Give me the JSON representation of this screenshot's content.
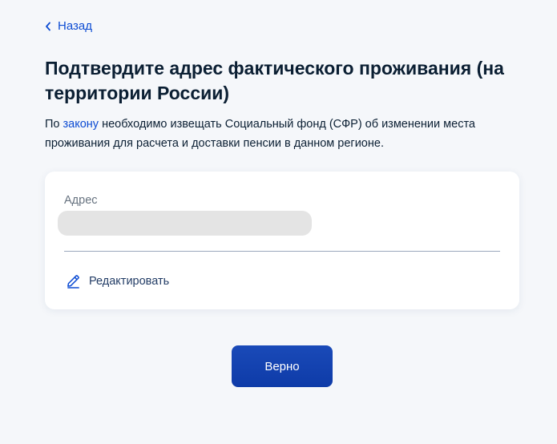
{
  "nav": {
    "back_label": "Назад",
    "back_icon": "chevron-left-icon"
  },
  "page": {
    "title": "Подтвердите адрес фактического проживания (на территории России)",
    "description_prefix": "По ",
    "description_link": "закону",
    "description_suffix": " необходимо извещать Социальный фонд (СФР) об изменении места проживания для расчета и доставки пенсии в данном регионе."
  },
  "address_card": {
    "label": "Адрес",
    "value_loading": true,
    "edit_label": "Редактировать",
    "edit_icon": "pencil-icon"
  },
  "actions": {
    "confirm_label": "Верно"
  },
  "colors": {
    "background": "#f5f7fa",
    "accent": "#0d4cd3",
    "button": "#0e3ba8",
    "text": "#0b1f33",
    "muted": "#66727f"
  }
}
